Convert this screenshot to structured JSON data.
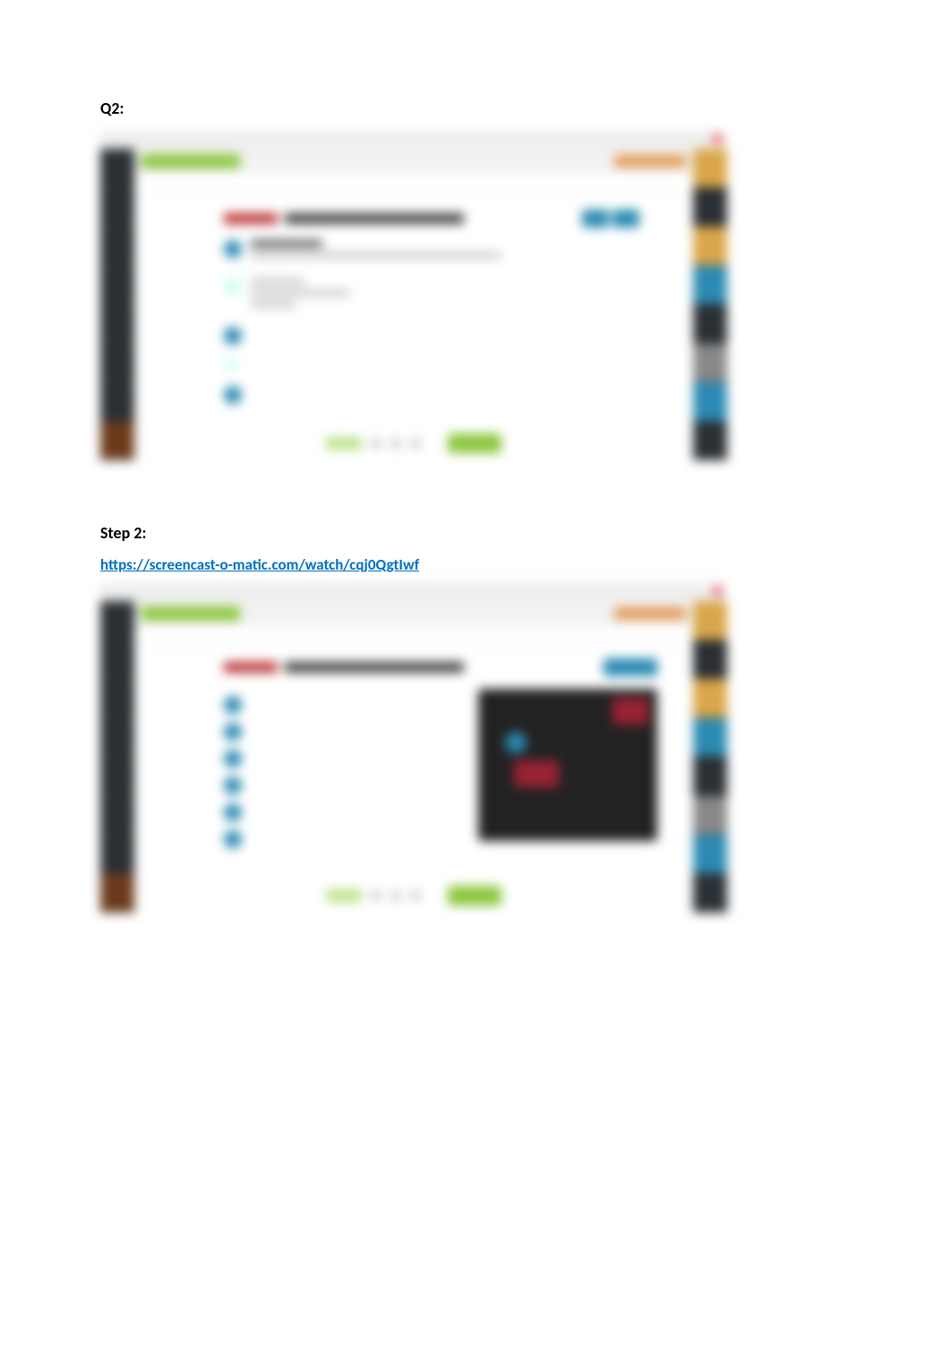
{
  "headings": {
    "q2": "Q2:",
    "step2": "Step 2:"
  },
  "link": {
    "text": "https://screencast-o-matic.com/watch/cqj0QgtIwf"
  }
}
